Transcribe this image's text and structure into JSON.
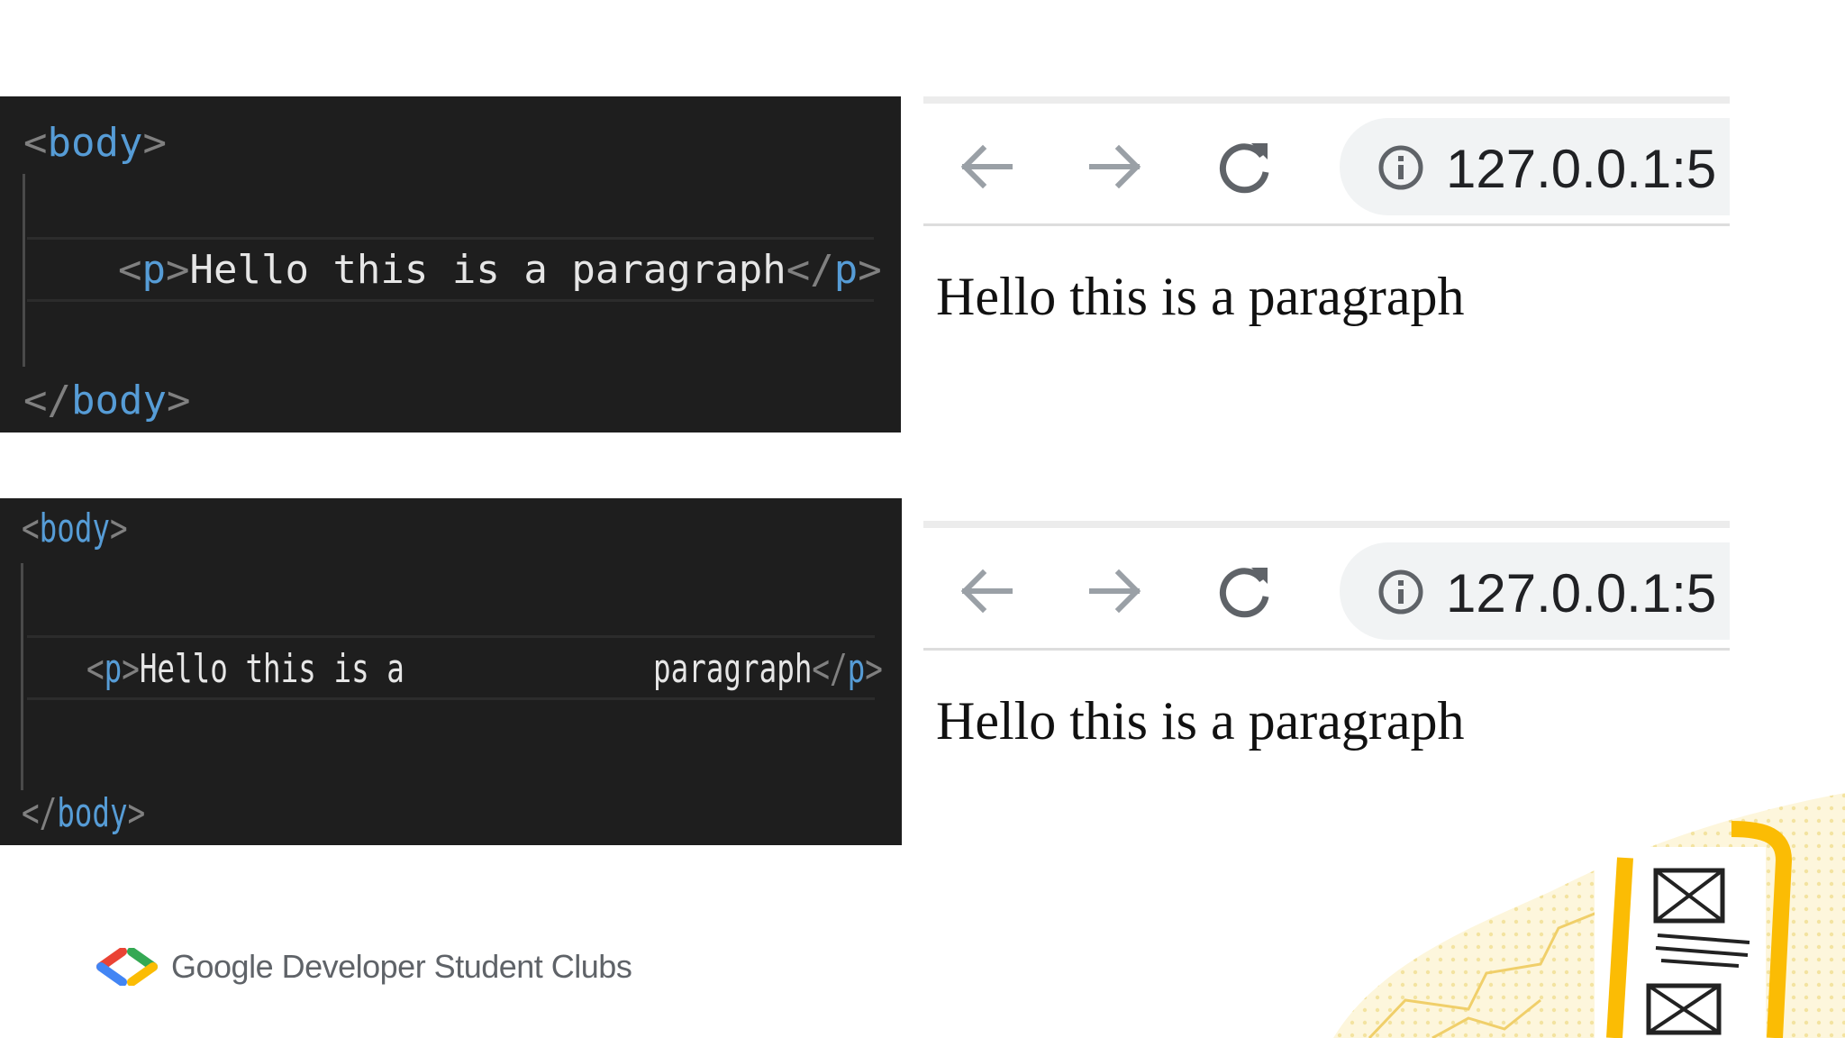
{
  "code_top": {
    "line1_open": "<",
    "line1_tag": "body",
    "line1_close": ">",
    "line2_open": "<",
    "line2_tag": "p",
    "line2_close": ">",
    "line2_text": "Hello this is a paragraph",
    "line2_end_open": "</",
    "line2_end_tag": "p",
    "line2_end_close": ">",
    "line3_open": "</",
    "line3_tag": "body",
    "line3_close": ">"
  },
  "code_bottom": {
    "line1_open": "<",
    "line1_tag": "body",
    "line1_close": ">",
    "line2_open": "<",
    "line2_tag": "p",
    "line2_close": ">",
    "line2_text_a": "Hello this is a",
    "line2_text_b": "paragraph",
    "line2_end_open": "</",
    "line2_end_tag": "p",
    "line2_end_close": ">",
    "line3_open": "</",
    "line3_tag": "body",
    "line3_close": ">"
  },
  "browser_top": {
    "url": "127.0.0.1:5",
    "content": "Hello this is a paragraph",
    "icons": [
      "back-arrow-icon",
      "forward-arrow-icon",
      "reload-icon",
      "info-icon"
    ]
  },
  "browser_bottom": {
    "url": "127.0.0.1:5",
    "content": "Hello this is a paragraph",
    "icons": [
      "back-arrow-icon",
      "forward-arrow-icon",
      "reload-icon",
      "info-icon"
    ]
  },
  "footer": {
    "brand": "Google Developer Student Clubs",
    "logo_colors": [
      "#ea4335",
      "#4285f4",
      "#34a853",
      "#fbbc04"
    ]
  },
  "colors": {
    "editor_bg": "#1e1e1e",
    "tag": "#569cd6",
    "punct": "#808080",
    "accent_yellow": "#fbbc04"
  }
}
